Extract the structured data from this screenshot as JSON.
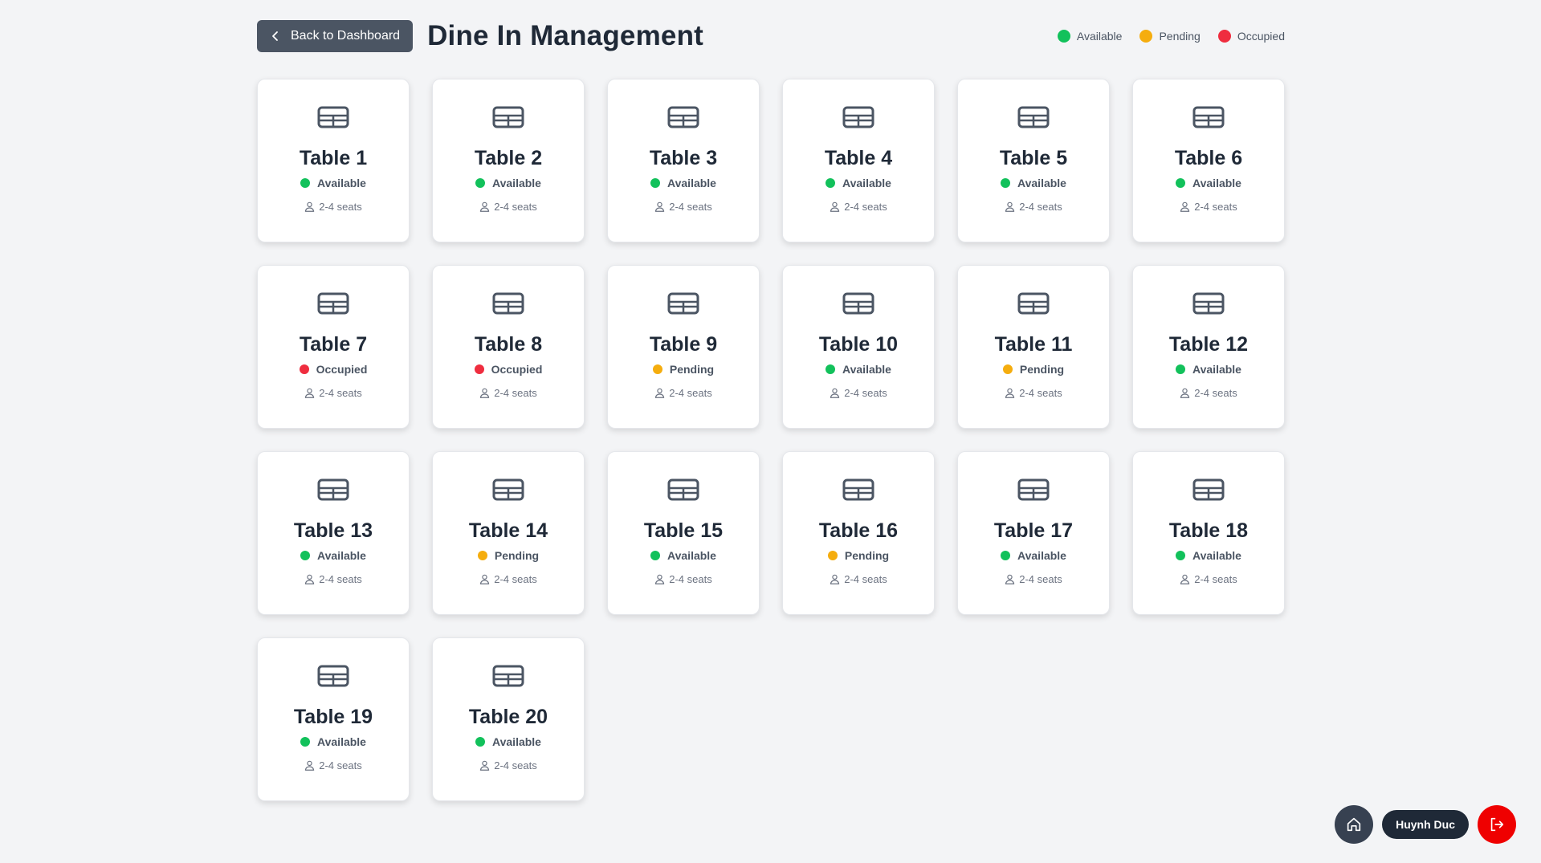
{
  "header": {
    "back_label": "Back to Dashboard",
    "title": "Dine In Management"
  },
  "legend": [
    {
      "label": "Available",
      "color": "#12c15b"
    },
    {
      "label": "Pending",
      "color": "#f5ad0e"
    },
    {
      "label": "Occupied",
      "color": "#ef2d3f"
    }
  ],
  "status_colors": {
    "Available": "#12c15b",
    "Pending": "#f5ad0e",
    "Occupied": "#ef2d3f"
  },
  "tables": [
    {
      "name": "Table 1",
      "status": "Available",
      "seats": "2-4 seats"
    },
    {
      "name": "Table 2",
      "status": "Available",
      "seats": "2-4 seats"
    },
    {
      "name": "Table 3",
      "status": "Available",
      "seats": "2-4 seats"
    },
    {
      "name": "Table 4",
      "status": "Available",
      "seats": "2-4 seats"
    },
    {
      "name": "Table 5",
      "status": "Available",
      "seats": "2-4 seats"
    },
    {
      "name": "Table 6",
      "status": "Available",
      "seats": "2-4 seats"
    },
    {
      "name": "Table 7",
      "status": "Occupied",
      "seats": "2-4 seats"
    },
    {
      "name": "Table 8",
      "status": "Occupied",
      "seats": "2-4 seats"
    },
    {
      "name": "Table 9",
      "status": "Pending",
      "seats": "2-4 seats"
    },
    {
      "name": "Table 10",
      "status": "Available",
      "seats": "2-4 seats"
    },
    {
      "name": "Table 11",
      "status": "Pending",
      "seats": "2-4 seats"
    },
    {
      "name": "Table 12",
      "status": "Available",
      "seats": "2-4 seats"
    },
    {
      "name": "Table 13",
      "status": "Available",
      "seats": "2-4 seats"
    },
    {
      "name": "Table 14",
      "status": "Pending",
      "seats": "2-4 seats"
    },
    {
      "name": "Table 15",
      "status": "Available",
      "seats": "2-4 seats"
    },
    {
      "name": "Table 16",
      "status": "Pending",
      "seats": "2-4 seats"
    },
    {
      "name": "Table 17",
      "status": "Available",
      "seats": "2-4 seats"
    },
    {
      "name": "Table 18",
      "status": "Available",
      "seats": "2-4 seats"
    },
    {
      "name": "Table 19",
      "status": "Available",
      "seats": "2-4 seats"
    },
    {
      "name": "Table 20",
      "status": "Available",
      "seats": "2-4 seats"
    }
  ],
  "footer": {
    "user_name": "Huynh Duc",
    "home_icon": "home-icon",
    "logout_icon": "logout-icon"
  }
}
